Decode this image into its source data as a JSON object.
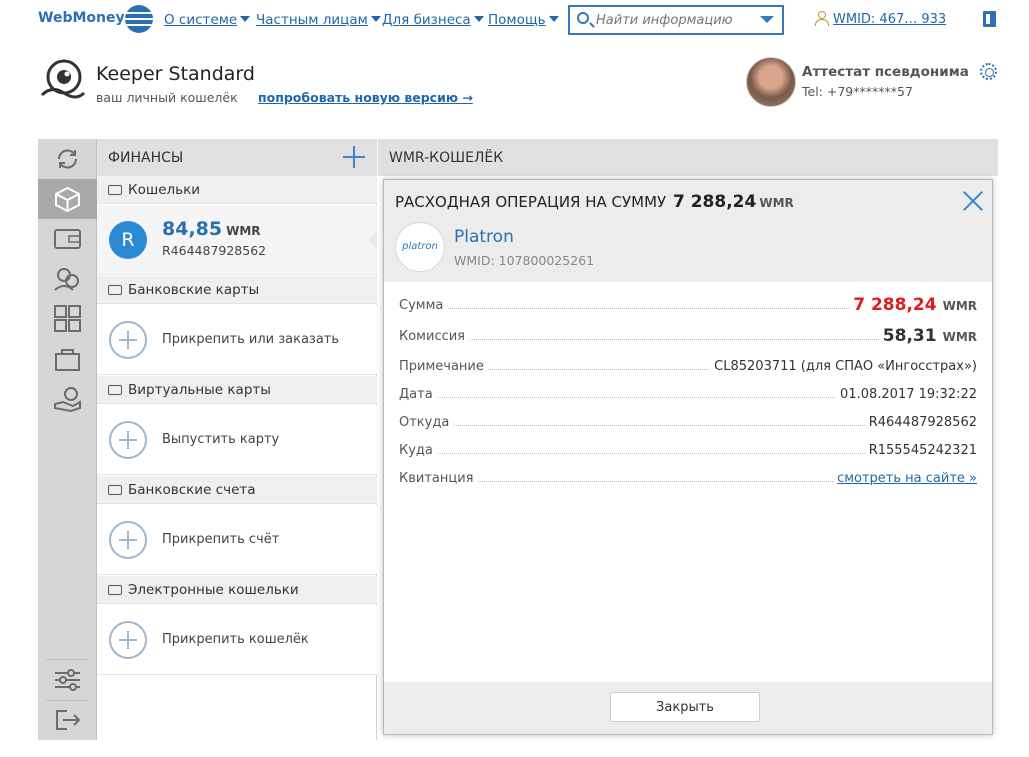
{
  "nav": {
    "brand": "WebMoney",
    "items": [
      {
        "label": "О системе"
      },
      {
        "label": "Частным лицам"
      },
      {
        "label": "Для бизнеса"
      },
      {
        "label": "Помощь"
      }
    ],
    "search_placeholder": "Найти информацию",
    "wmid": "WMID: 467… 933"
  },
  "header": {
    "title": "Keeper Standard",
    "subtitle": "ваш личный кошелёк",
    "try_new": "попробовать новую версию →",
    "attestat": "Аттестат псевдонима",
    "tel": "Tel: +79*******57"
  },
  "finance": {
    "title": "ФИНАНСЫ",
    "sections": {
      "wallets": "Кошельки",
      "bank_cards": "Банковские карты",
      "virtual_cards": "Виртуальные карты",
      "bank_accounts": "Банковские счета",
      "e_wallets": "Электронные кошельки"
    },
    "wallet": {
      "badge": "R",
      "amount": "84,85",
      "currency": "WMR",
      "id": "R464487928562"
    },
    "actions": {
      "bank_cards": "Прикрепить или заказать",
      "virtual_cards": "Выпустить карту",
      "bank_accounts": "Прикрепить счёт",
      "e_wallets": "Прикрепить кошелёк"
    }
  },
  "content": {
    "title": "WMR-КОШЕЛЁК"
  },
  "dialog": {
    "title": "РАСХОДНАЯ ОПЕРАЦИЯ НА СУММУ",
    "amount": "7 288,24",
    "currency": "WMR",
    "recipient": {
      "logo_text": "platron",
      "name": "Platron",
      "wmid": "WMID: 107800025261"
    },
    "rows": [
      {
        "label": "Сумма",
        "value": "7 288,24",
        "currency": "WMR"
      },
      {
        "label": "Комиссия",
        "value": "58,31",
        "currency": "WMR"
      },
      {
        "label": "Примечание",
        "value": "CL85203711 (для СПАО «Ингосстрах»)"
      },
      {
        "label": "Дата",
        "value": "01.08.2017 19:32:22"
      },
      {
        "label": "Откуда",
        "value": "R464487928562"
      },
      {
        "label": "Куда",
        "value": "R155545242321"
      },
      {
        "label": "Квитанция",
        "value": "смотреть на сайте »"
      }
    ],
    "close_label": "Закрыть"
  },
  "colors": {
    "brand": "#2c6fb6",
    "accent": "#3a86c8",
    "amount_red": "#e01b1b",
    "panel_gray": "#e0e0e0"
  }
}
